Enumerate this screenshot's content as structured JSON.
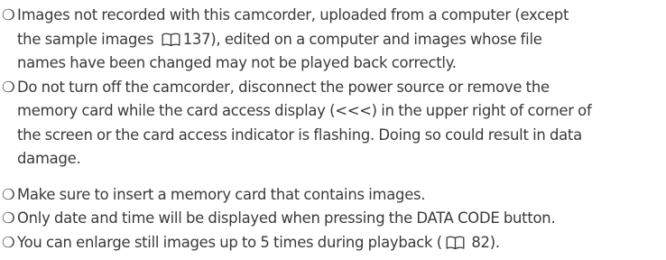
{
  "notes_group_1": [
    {
      "lines": [
        [
          "Images not recorded with this camcorder, uploaded from a computer (except"
        ],
        [
          "the sample images ",
          {
            "icon": "book-icon"
          },
          "137), edited on a computer and images whose file"
        ],
        [
          "names have been changed may not be played back correctly."
        ]
      ]
    },
    {
      "lines": [
        [
          "Do not turn off the camcorder, disconnect the power source or remove the"
        ],
        [
          "memory card while the card access display (<<<) in the upper right of corner of"
        ],
        [
          "the screen or the card access indicator is flashing. Doing so could result in data"
        ],
        [
          "damage."
        ]
      ]
    }
  ],
  "notes_group_2": [
    {
      "lines": [
        [
          "Make sure to insert a memory card that contains images."
        ]
      ]
    },
    {
      "lines": [
        [
          "Only date and time will be displayed when pressing the DATA CODE button."
        ]
      ]
    },
    {
      "lines": [
        [
          "You can enlarge still images up to 5 times during playback (",
          {
            "icon": "book-icon"
          },
          " 82)."
        ]
      ]
    }
  ],
  "bullet_symbol": "❍",
  "colors": {
    "text": "#3a3a3a",
    "background": "#ffffff"
  }
}
